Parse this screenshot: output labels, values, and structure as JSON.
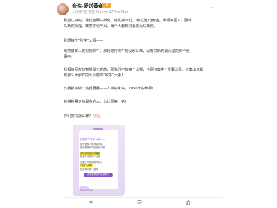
{
  "post": {
    "username": "俞浩-爱送黄金",
    "vip_badge": "V",
    "meta": "12分钟前 来自 Xiaomi 17 Pro Max",
    "body": [
      "我是认真的。寻找全网马斯克。转发抽10位，每位送1g黄金。带领中国人，要对",
      "马斯克祝福。转发你也可以。每个人都有机会成为马斯克。",
      "我想搞个“吹牛”大赛——",
      "既然很多人觉得我吹牛，那我觉得吹牛也没那么难，没有马斯克去火星的那个胆",
      "事吧。",
      "我相信网友的智慧是无穷的，那我们不如搞个比赛，全网征集牛^吹事比赛。征集出马斯",
      "克那么大那样的大火箭的“吹牛”大事！",
      "比赛就叫做：追觅惠赛——人类的未来，2050年的世界！",
      "获得投票支持最多的人，为比赛第一名！",
      "你们觉得怎么样？",
      "收起"
    ]
  },
  "card": {
    "lines": [
      "我想搞个“吹牛”大赛——",
      "既然很多人觉得我吹牛，",
      "那我觉得吹牛也没什么难",
      "我相信网友们的智慧",
      "那我们不如搞个比赛",
      "征集出马斯克那样的大",
      "“吹牛”大事！",
      "比赛就叫做：追觅"
    ],
    "button": "获得投票支持最多的人",
    "footer": "追觅科技"
  },
  "actions": {
    "repost": "",
    "comment": "",
    "like": ""
  }
}
